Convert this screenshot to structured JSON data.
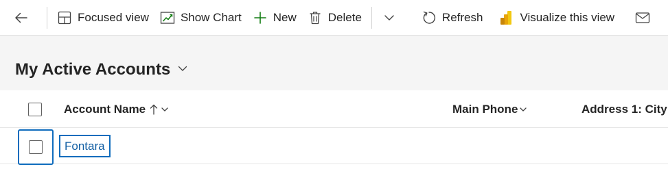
{
  "commandbar": {
    "focused_view": "Focused view",
    "show_chart": "Show Chart",
    "new": "New",
    "delete": "Delete",
    "refresh": "Refresh",
    "visualize": "Visualize this view"
  },
  "view": {
    "title": "My Active Accounts"
  },
  "grid": {
    "columns": [
      "Account Name",
      "Main Phone",
      "Address 1: City"
    ],
    "sort": {
      "column": "Account Name",
      "direction": "ascending"
    },
    "rows": [
      {
        "account_name": "Fontara",
        "main_phone": "",
        "city": ""
      }
    ]
  },
  "colors": {
    "accent": "#0f6cbd",
    "link": "#115ea3",
    "new_icon": "#107c10",
    "powerbi_yellow": "#f2c811"
  }
}
